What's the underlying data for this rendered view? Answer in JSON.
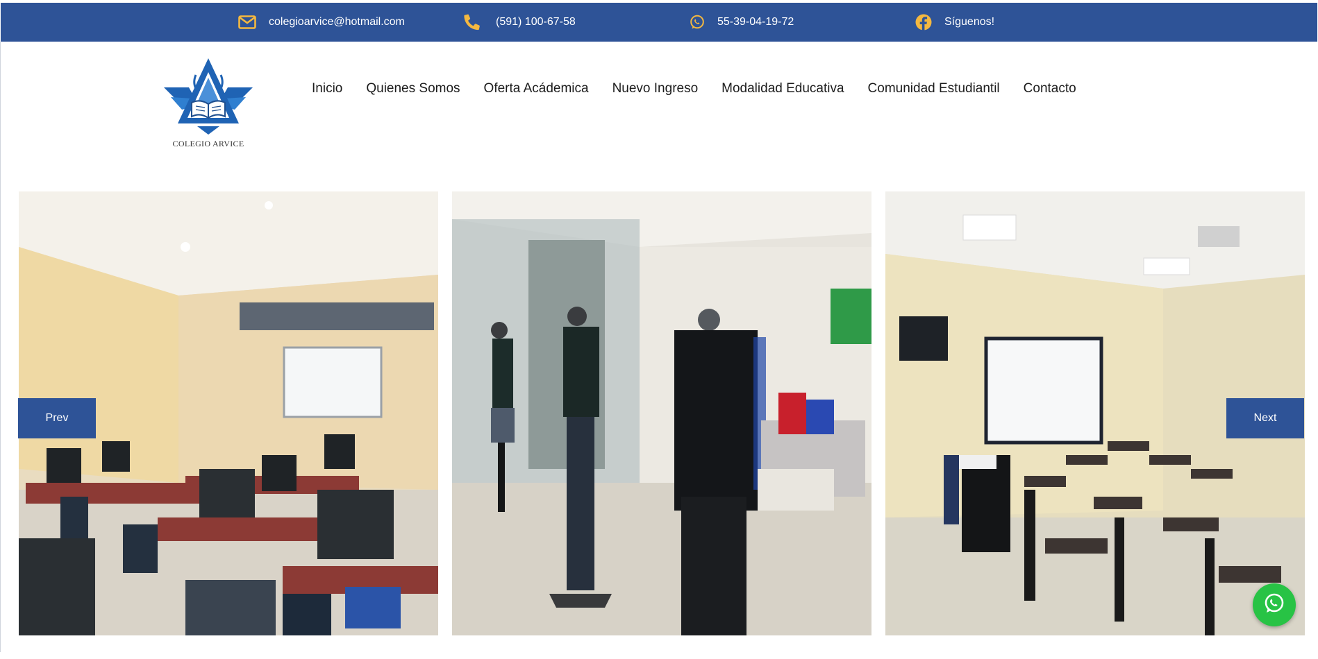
{
  "topbar": {
    "email": "colegioarvice@hotmail.com",
    "phone": "(591) 100-67-58",
    "whatsapp": "55-39-04-19-72",
    "social": "Síguenos!",
    "icon_color": "#f4b840",
    "background": "#2e5397",
    "icons": [
      "envelope-icon",
      "phone-icon",
      "whatsapp-icon",
      "facebook-icon"
    ]
  },
  "logo": {
    "text": "COLEGIO ARVICE",
    "color": "#1f63b4"
  },
  "nav": {
    "items": [
      "Inicio",
      "Quienes Somos",
      "Oferta Acádemica",
      "Nuevo Ingreso",
      "Modalidad Educativa",
      "Comunidad Estudiantil",
      "Contacto"
    ]
  },
  "carousel": {
    "prev_label": "Prev",
    "next_label": "Next",
    "slides": [
      "computer-lab-photo",
      "school-uniforms-photo",
      "classroom-photo"
    ]
  },
  "floating": {
    "whatsapp_icon": "whatsapp-icon",
    "color": "#28c345"
  }
}
